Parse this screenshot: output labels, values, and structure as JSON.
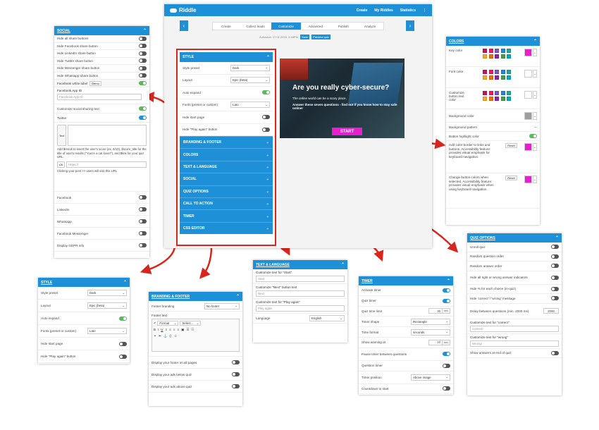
{
  "app": {
    "logo": "Riddle",
    "nav": [
      "Create",
      "My Riddles",
      "Statistics"
    ],
    "more": "⋮",
    "steps": [
      "Create",
      "Collect leads",
      "Customize",
      "Advanced",
      "Publish",
      "Analyze"
    ],
    "active_step": 2,
    "autosave": "Autosave: 17.01.2020, 3:48PM",
    "save": "Save",
    "preview": "Preview quiz",
    "hero_title": "Are you really cyber-secure?",
    "hero_text1": "The online world can be a scary place.",
    "hero_text2": "Answer these seven questions - find out if you know how to stay safe online!",
    "hero_button": "START"
  },
  "editor": {
    "style_title": "STYLE",
    "rows": [
      {
        "label": "Style preset",
        "value": "Dark"
      },
      {
        "label": "Layout",
        "value": "Epic (beta)"
      },
      {
        "label": "Auto expand",
        "toggle": true
      },
      {
        "label": "Fonts (preset or custom)",
        "value": "Lato"
      },
      {
        "label": "Hide start page",
        "toggle": false
      },
      {
        "label": "Hide \"Play again\" button",
        "toggle": false
      }
    ],
    "sections": [
      "BRANDING & FOOTER",
      "COLORS",
      "TEXT & LANGUAGE",
      "SOCIAL",
      "QUIZ OPTIONS",
      "CALL TO ACTION",
      "TIMER",
      "CSS EDITOR"
    ]
  },
  "social": {
    "title": "SOCIAL",
    "hide": [
      "Hide all share buttons",
      "Hide Facebook share button",
      "Hide LinkedIn share button",
      "Hide Twitter share button",
      "Hide Messenger share button",
      "Hide Whatsapp share button"
    ],
    "fb_label": "Facebook white label",
    "demo": "Demo",
    "fb_app": "Facebook App ID",
    "fb_app_ph": "Facebook App ID",
    "custom_sharing": "Customize social sharing text",
    "twitter": "Twitter",
    "text_label": "Text",
    "help": "Add $result to insert the user's score (ex. 6/10), $score_title for the title of user's results (\"You're a cat lover!\"), and $link for your quiz URL.",
    "url_label": "Url",
    "url_ph": "Https://",
    "url_help": "Clicking your post >> users will visit this URL",
    "networks": [
      "Facebook",
      "LinkedIn",
      "Whatsapp",
      "Facebook Messenger",
      "Display GDPR info"
    ]
  },
  "colors": {
    "title": "COLORS",
    "key": "Key color",
    "font": "Font color",
    "button": "Customize button text color",
    "bg": "Background color",
    "pattern": "Background pattern",
    "highlight": "Button highlight color",
    "border": "Add color border to links and buttons. Accessibility feature: provides visual emphasis for keyboard navigation.",
    "change": "Change button colors when selected. Accessibility feature: provides visual emphasis when using keyboard navigation.",
    "reset": "Reset",
    "palette": [
      "#c2185b",
      "#e91e63",
      "#7e57c2",
      "#1e88e5",
      "#26a69a",
      "#f9a825",
      "#ef6c00",
      "#8e24aa",
      "#43a047",
      "#00acc1"
    ],
    "magenta": "#e91ecf"
  },
  "style2": {
    "title": "STYLE",
    "rows": [
      {
        "label": "Style preset",
        "value": "Dark"
      },
      {
        "label": "Layout",
        "value": "Epic (beta)"
      },
      {
        "label": "Auto expand",
        "toggle": true
      },
      {
        "label": "Fonts (preset or custom)",
        "value": "Lato"
      },
      {
        "label": "Hide start page",
        "toggle": false
      },
      {
        "label": "Hide \"Play again\" button",
        "toggle": false
      }
    ]
  },
  "branding": {
    "title": "BRANDING & FOOTER",
    "footer_branding": "Footer branding",
    "footer_value": "No footer",
    "footer_text": "Footer text",
    "format": "Format",
    "font": "Select...",
    "toggles": [
      "Display your footer on all pages",
      "Display your ads below quiz",
      "Display your ads above quiz"
    ]
  },
  "text": {
    "title": "TEXT & LANGUAGE",
    "start_label": "Customize text for \"Start\"",
    "start_ph": "Start",
    "next_label": "Customize \"Next\" button text",
    "next_ph": "Next",
    "again_label": "Customize text for \"Play again\"",
    "again_ph": "Play again",
    "lang_label": "Language",
    "lang_value": "English"
  },
  "timer": {
    "title": "TIMER",
    "rows": [
      {
        "label": "Activate timer",
        "kind": "toggle",
        "on": true
      },
      {
        "label": "Quiz timer",
        "kind": "toggle",
        "on": true
      },
      {
        "label": "Quiz time limit",
        "kind": "num",
        "value": "30",
        "unit": "sec"
      },
      {
        "label": "Timer shape",
        "kind": "select",
        "value": "Rectangle"
      },
      {
        "label": "Time format",
        "kind": "select",
        "value": "seconds"
      },
      {
        "label": "Show warning at",
        "kind": "num",
        "value": "10",
        "unit": "sec"
      },
      {
        "label": "Pause timer between questions",
        "kind": "toggle",
        "on": true
      },
      {
        "label": "Question timer",
        "kind": "toggle",
        "on": false
      },
      {
        "label": "Timer position",
        "kind": "select",
        "value": "Above image"
      },
      {
        "label": "Countdown to start",
        "kind": "toggle",
        "on": false
      }
    ]
  },
  "quiz": {
    "title": "QUIZ OPTIONS",
    "rows": [
      {
        "label": "Unroll quiz"
      },
      {
        "label": "Random question order"
      },
      {
        "label": "Random answer order"
      },
      {
        "label": "Hide all right or wrong answer indicators"
      },
      {
        "label": "Hide % for each choice (in-quiz)"
      },
      {
        "label": "Hide 'correct' / 'wrong' message"
      }
    ],
    "delay_label": "Delay between questions (min. 2000 ms)",
    "delay_value": "2000",
    "correct_label": "Customize text for \"correct\"",
    "correct_ph": "Correct!",
    "wrong_label": "Customize text for \"wrong\"",
    "wrong_ph": "Wrong!",
    "show_answers": "Show answers at end of quiz"
  }
}
